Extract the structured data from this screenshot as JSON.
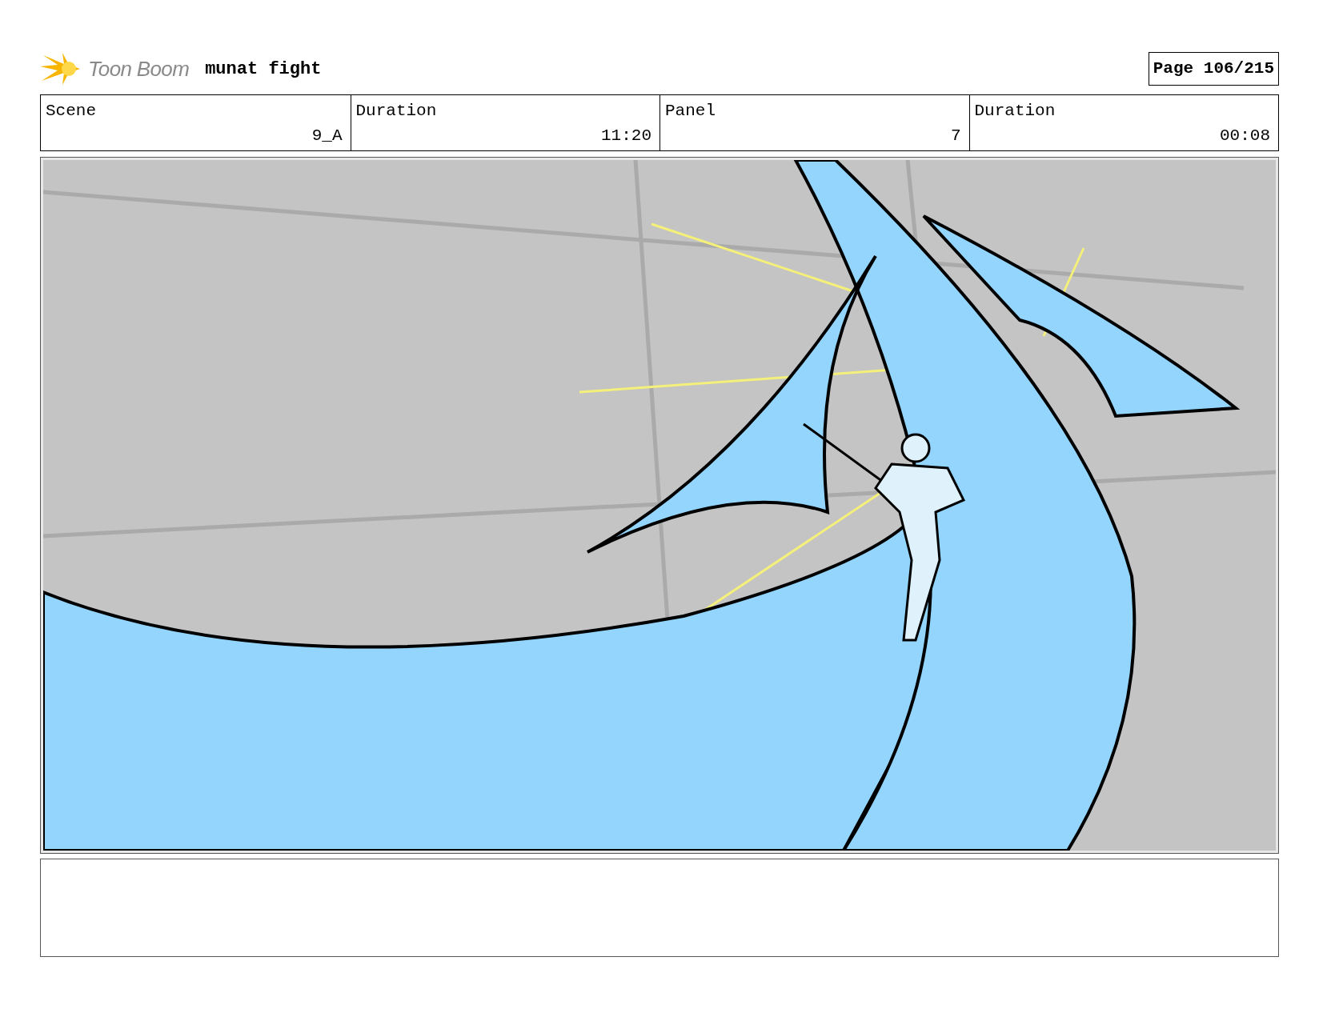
{
  "header": {
    "logo_text": "Toon Boom",
    "project": "munat fight",
    "page": "Page 106/215"
  },
  "info_labels": [
    "Scene",
    "Duration",
    "Panel",
    "Duration"
  ],
  "info_values": [
    "9_A",
    "11:20",
    "7",
    "00:08"
  ]
}
